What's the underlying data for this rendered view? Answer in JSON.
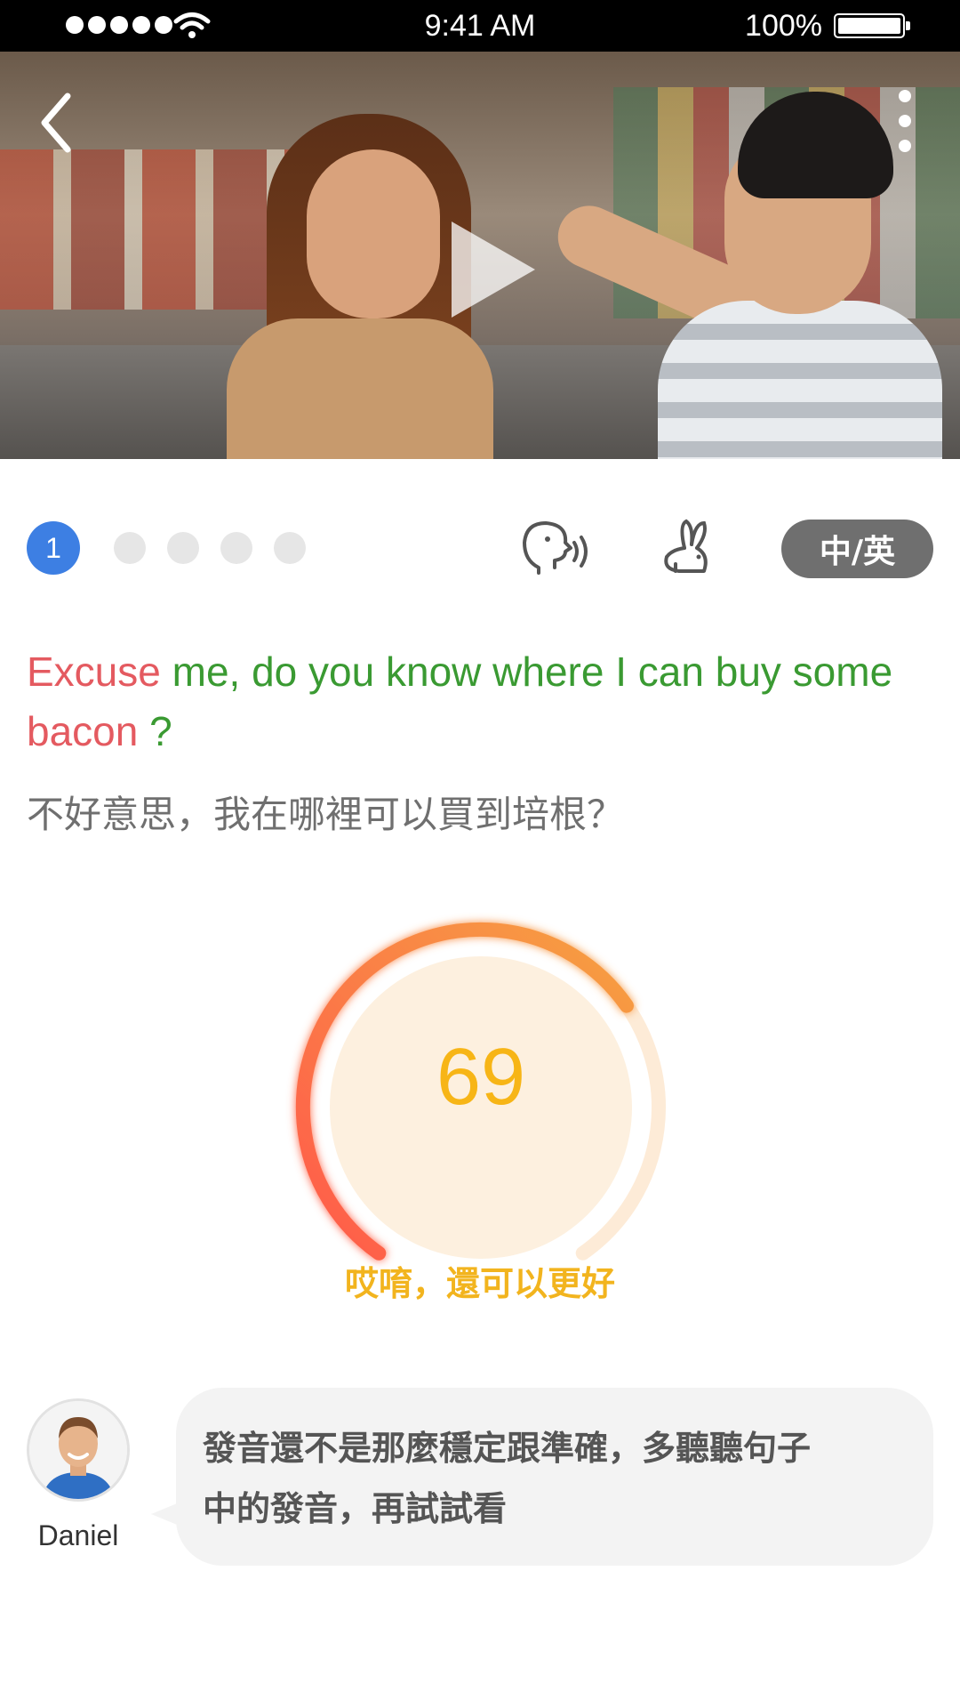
{
  "status_bar": {
    "time": "9:41 AM",
    "battery": "100%"
  },
  "video": {
    "play_icon": "play-icon",
    "back_icon": "chevron-left-icon",
    "more_icon": "more-vertical-icon"
  },
  "progress": {
    "current": "1",
    "total_dots": 5
  },
  "controls": {
    "speak_icon": "speaking-head-icon",
    "slow_icon": "rabbit-icon",
    "language_toggle": "中/英"
  },
  "sentence": {
    "words": [
      {
        "text": "Excuse",
        "status": "wrong",
        "color": "#e45a60"
      },
      {
        "text": " me, do you know where I can buy some",
        "status": "good",
        "color": "#3a9a32"
      },
      {
        "text": " bacon",
        "status": "wrong",
        "color": "#e45a60"
      },
      {
        "text": " ?",
        "status": "good",
        "color": "#3a9a32"
      }
    ],
    "translation": "不好意思，我在哪裡可以買到培根？"
  },
  "score": {
    "value": "69",
    "fraction": 0.69,
    "message": "哎唷，還可以更好",
    "colors": {
      "arc_start": "#ff5a4a",
      "arc_end": "#f6a142",
      "number": "#f7b516"
    }
  },
  "coach": {
    "name": "Daniel",
    "feedback_line1": "發音還不是那麼穩定跟準確，多聽聽句子",
    "feedback_line2": "中的發音，再試試看"
  }
}
